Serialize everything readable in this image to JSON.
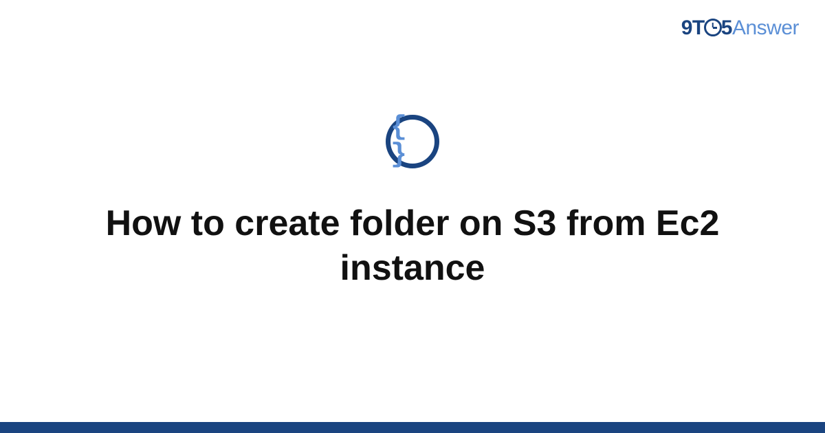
{
  "brand": {
    "part1": "9T",
    "part2": "5",
    "part3": "Answer"
  },
  "category": {
    "icon_glyph": "{ }",
    "icon_name": "code-braces-icon"
  },
  "question": {
    "title": "How to create folder on S3 from Ec2 instance"
  },
  "colors": {
    "primary": "#1a4480",
    "accent": "#5b8fd6"
  }
}
